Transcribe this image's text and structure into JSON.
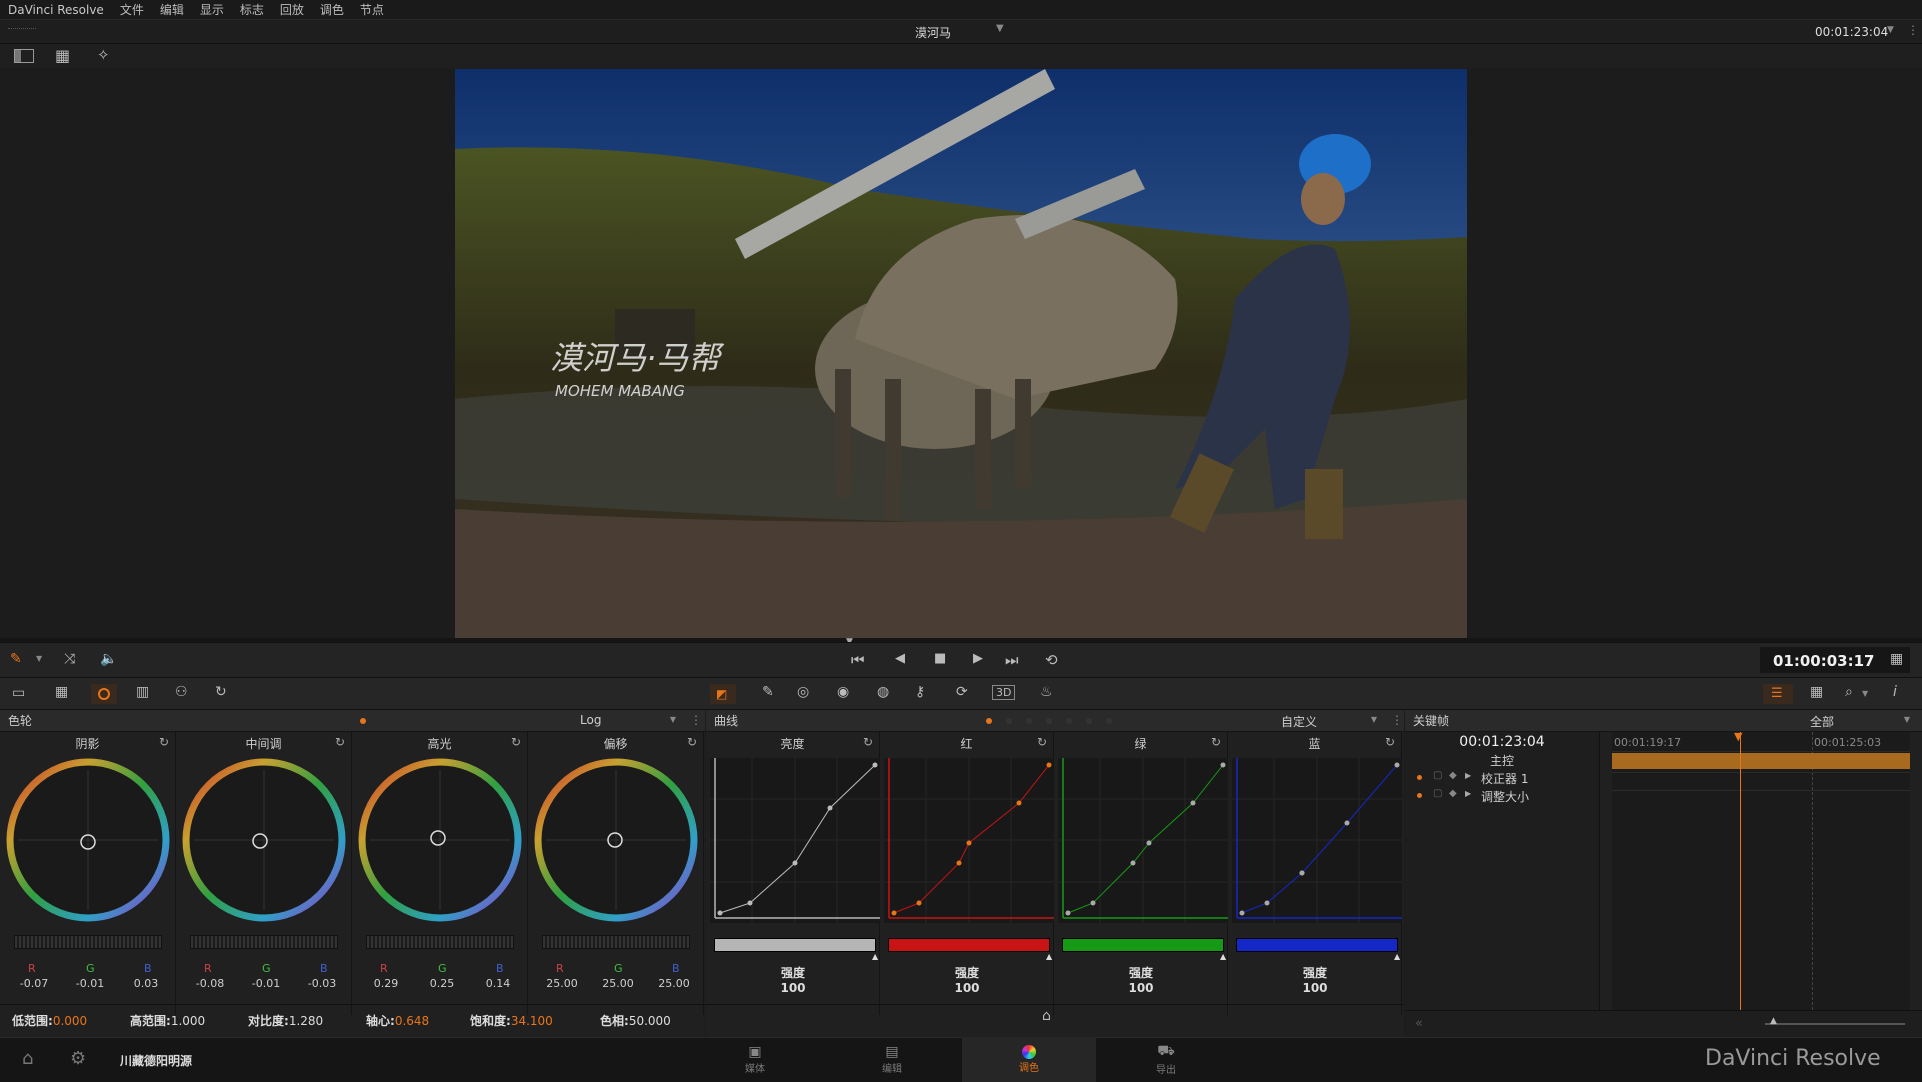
{
  "menubar": {
    "app": "DaVinci Resolve",
    "items": [
      "文件",
      "编辑",
      "显示",
      "标志",
      "回放",
      "调色",
      "节点"
    ]
  },
  "titlebar": {
    "clip_name": "漠河马",
    "timecode": "00:01:23:04"
  },
  "viewer": {
    "overlay_title": "漠河马·马帮",
    "overlay_subtitle": "MOHEM MABANG"
  },
  "transport": {
    "timecode": "01:00:03:17"
  },
  "colorwheels": {
    "title": "色轮",
    "mode": "Log",
    "wheels": [
      {
        "label": "阴影",
        "r": "-0.07",
        "g": "-0.01",
        "b": "0.03"
      },
      {
        "label": "中间调",
        "r": "-0.08",
        "g": "-0.01",
        "b": "-0.03"
      },
      {
        "label": "高光",
        "r": "0.29",
        "g": "0.25",
        "b": "0.14"
      },
      {
        "label": "偏移",
        "r": "25.00",
        "g": "25.00",
        "b": "25.00"
      }
    ],
    "rgb_letters": {
      "r": "R",
      "g": "G",
      "b": "B"
    },
    "params": [
      {
        "label": "低范围:",
        "value": "0.000",
        "accent": true
      },
      {
        "label": "高范围:",
        "value": "1.000",
        "accent": false
      },
      {
        "label": "对比度:",
        "value": "1.280",
        "accent": false
      },
      {
        "label": "轴心:",
        "value": "0.648",
        "accent": true
      },
      {
        "label": "饱和度:",
        "value": "34.100",
        "accent": true
      },
      {
        "label": "色相:",
        "value": "50.000",
        "accent": false
      }
    ]
  },
  "curves": {
    "title": "曲线",
    "mode": "自定义",
    "channels": [
      {
        "label": "亮度",
        "strength_label": "强度",
        "strength": "100",
        "color": "#b5b5b5"
      },
      {
        "label": "红",
        "strength_label": "强度",
        "strength": "100",
        "color": "#c81414"
      },
      {
        "label": "绿",
        "strength_label": "强度",
        "strength": "100",
        "color": "#169a16"
      },
      {
        "label": "蓝",
        "strength_label": "强度",
        "strength": "100",
        "color": "#1428c8"
      }
    ]
  },
  "keyframes": {
    "title": "关键帧",
    "mode": "全部",
    "timecode": "00:01:23:04",
    "ruler": [
      "00:01:19:17",
      "00:01:25:03"
    ],
    "tracks": [
      "主控",
      "校正器 1",
      "调整大小"
    ]
  },
  "bottom": {
    "project": "川藏德阳明源",
    "tabs": [
      {
        "label": "媒体"
      },
      {
        "label": "编辑"
      },
      {
        "label": "调色"
      },
      {
        "label": "导出"
      }
    ],
    "brand": "DaVinci Resolve"
  },
  "colors": {
    "accent": "#e8751a",
    "panel": "#202020",
    "bg": "#1c1c1c"
  }
}
